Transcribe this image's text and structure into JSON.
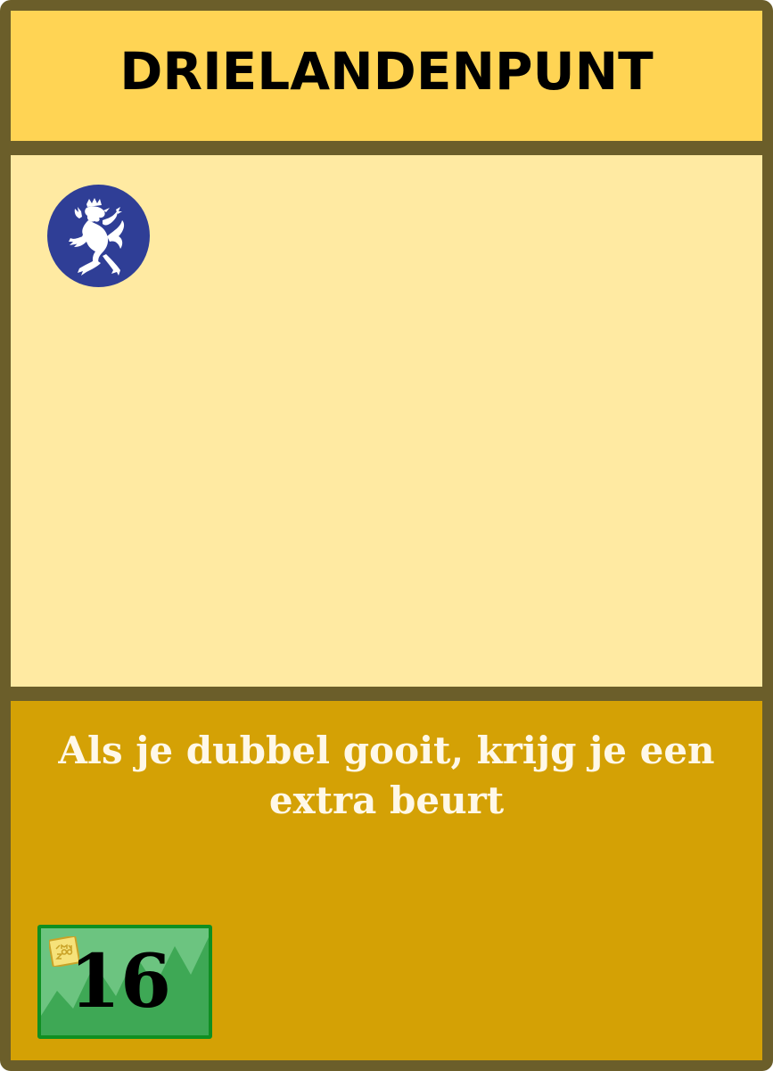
{
  "card": {
    "title": "DRIELANDENPUNT",
    "rule_text": "Als je dubbel gooit, krijg je een extra beurt",
    "price": "16",
    "emblem_icon": "lion-rampant-icon",
    "stamp_icon": "gmzoo-stamp-icon",
    "colors": {
      "border": "#6b5e2a",
      "title_bg": "#ffd454",
      "image_bg": "#ffeaa2",
      "text_bg": "#d4a105",
      "emblem_bg": "#2f3e96",
      "price_bg": "#6cc480",
      "price_border": "#0f8f22"
    }
  }
}
